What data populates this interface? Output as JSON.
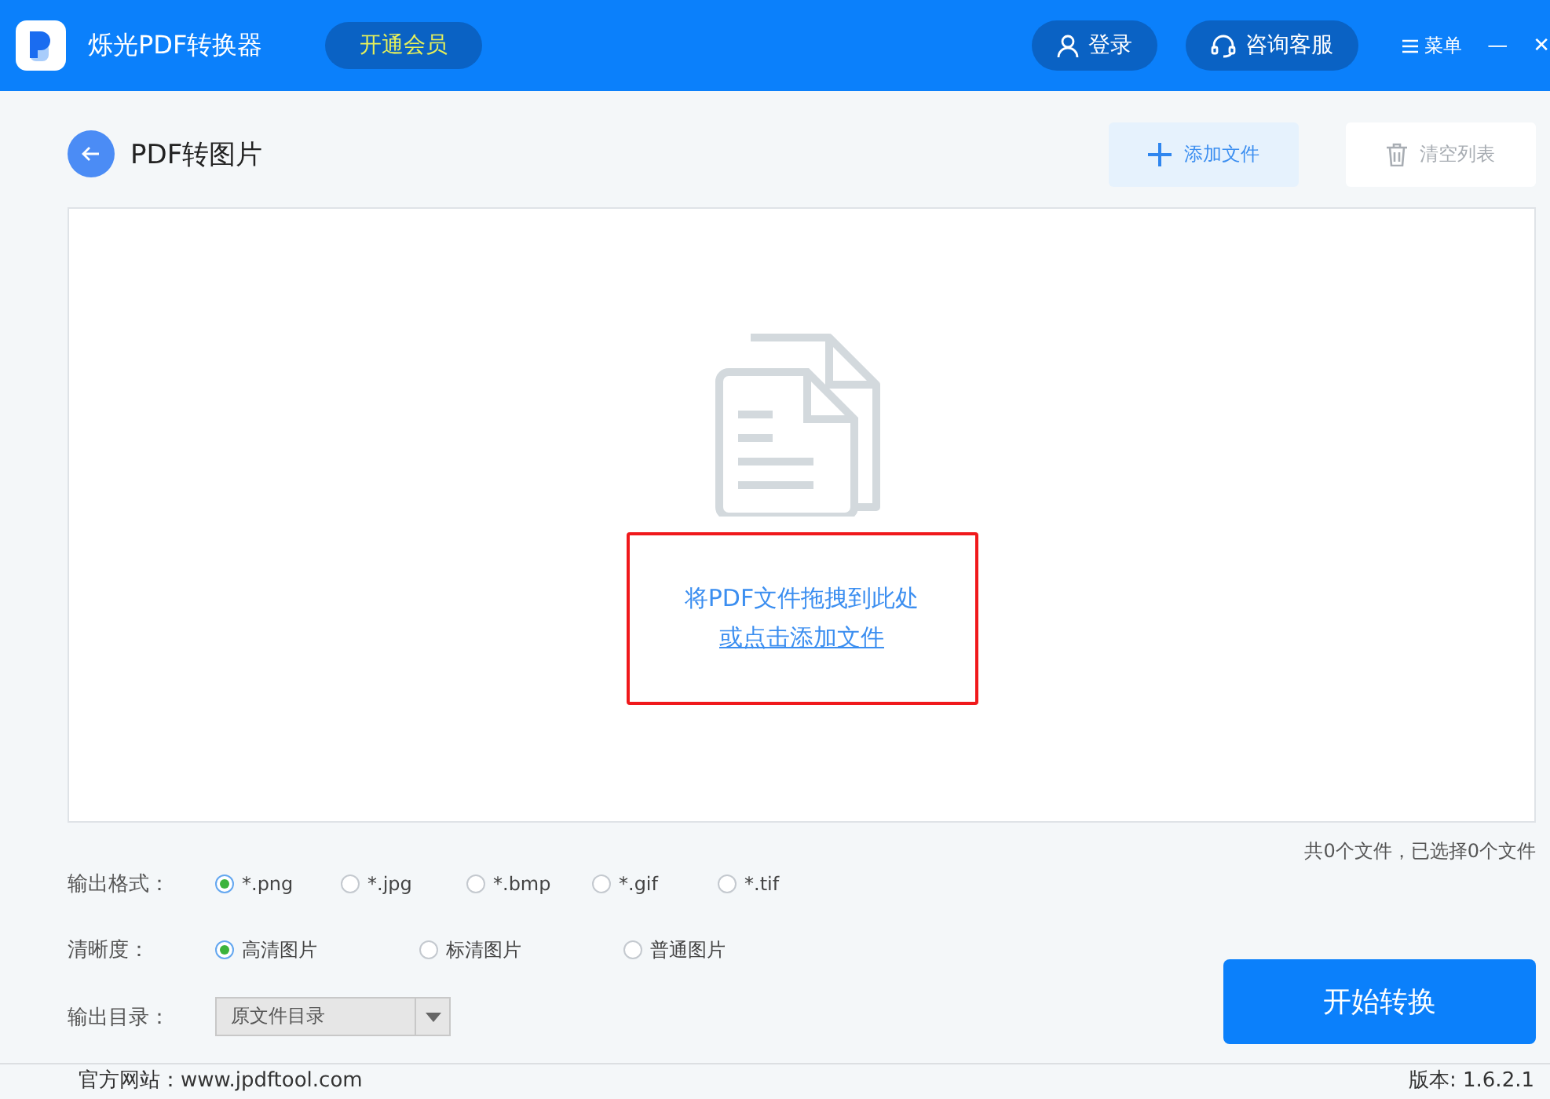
{
  "app": {
    "title": "烁光PDF转换器",
    "vip_button": "开通会员",
    "login_button": "登录",
    "support_button": "咨询客服",
    "menu_button": "菜单",
    "window_controls": [
      "—",
      "✕"
    ]
  },
  "page": {
    "title": "PDF转图片",
    "add_button": "添加文件",
    "clear_button": "清空列表",
    "clear_disabled": true
  },
  "drop_zone": {
    "hint": "将PDF文件拖拽到此处",
    "link": "或点击添加文件",
    "highlighted": true
  },
  "file_count": "共0个文件，已选择0个文件",
  "format": {
    "label": "输出格式：",
    "options": [
      {
        "label": "*.png",
        "selected": true
      },
      {
        "label": "*.jpg",
        "selected": false
      },
      {
        "label": "*.bmp",
        "selected": false
      },
      {
        "label": "*.gif",
        "selected": false
      },
      {
        "label": "*.tif",
        "selected": false
      }
    ]
  },
  "quality": {
    "label": "清晰度：",
    "options": [
      {
        "label": "高清图片",
        "selected": true
      },
      {
        "label": "标清图片",
        "selected": false
      },
      {
        "label": "普通图片",
        "selected": false
      }
    ]
  },
  "output_dir": {
    "label": "输出目录：",
    "value": "原文件目录"
  },
  "start_button": "开始转换",
  "footer": {
    "website": "官方网站：www.jpdftool.com",
    "version": "版本: 1.6.2.1"
  }
}
